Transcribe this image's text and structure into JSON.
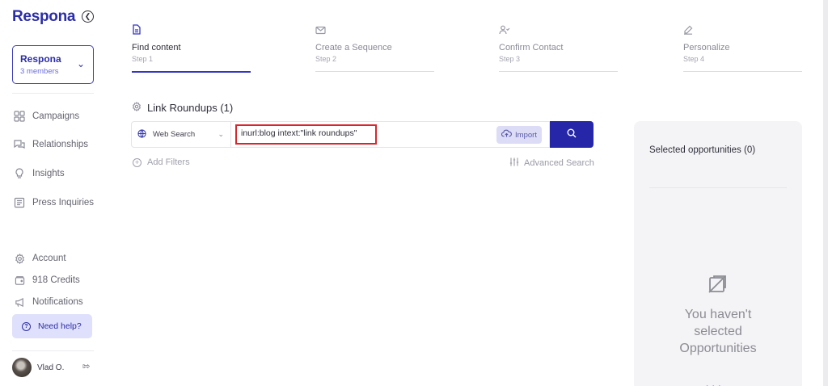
{
  "app": {
    "logo": "Respona"
  },
  "workspace": {
    "name": "Respona",
    "members": "3 members"
  },
  "nav": {
    "items": [
      {
        "label": "Campaigns",
        "icon": "grid-icon"
      },
      {
        "label": "Relationships",
        "icon": "chat-icon"
      },
      {
        "label": "Insights",
        "icon": "lightbulb-icon"
      },
      {
        "label": "Press Inquiries",
        "icon": "newspaper-icon"
      }
    ],
    "bottom": [
      {
        "label": "Account",
        "icon": "gear-icon"
      },
      {
        "label": "918 Credits",
        "icon": "wallet-icon"
      },
      {
        "label": "Notifications",
        "icon": "megaphone-icon"
      }
    ],
    "help": "Need help?"
  },
  "user": {
    "name": "Vlad O."
  },
  "steps": [
    {
      "title": "Find content",
      "sub": "Step 1",
      "icon": "document-icon",
      "active": true
    },
    {
      "title": "Create a Sequence",
      "sub": "Step 2",
      "icon": "mail-icon",
      "active": false
    },
    {
      "title": "Confirm Contact",
      "sub": "Step 3",
      "icon": "user-check-icon",
      "active": false
    },
    {
      "title": "Personalize",
      "sub": "Step 4",
      "icon": "pen-icon",
      "active": false
    }
  ],
  "main": {
    "section_title": "Link Roundups (1)",
    "source": "Web Search",
    "query": "inurl:blog intext:\"link roundups\"",
    "import_label": "Import",
    "add_filters": "Add Filters",
    "advanced_search": "Advanced Search"
  },
  "panel": {
    "title": "Selected opportunities (0)",
    "empty_line1": "You haven't",
    "empty_line2": "selected",
    "empty_line3": "Opportunities"
  },
  "colors": {
    "brand": "#2c2ea8",
    "button": "#2627a8",
    "highlight": "#d9262c",
    "help_bg": "#dfe0fb"
  }
}
